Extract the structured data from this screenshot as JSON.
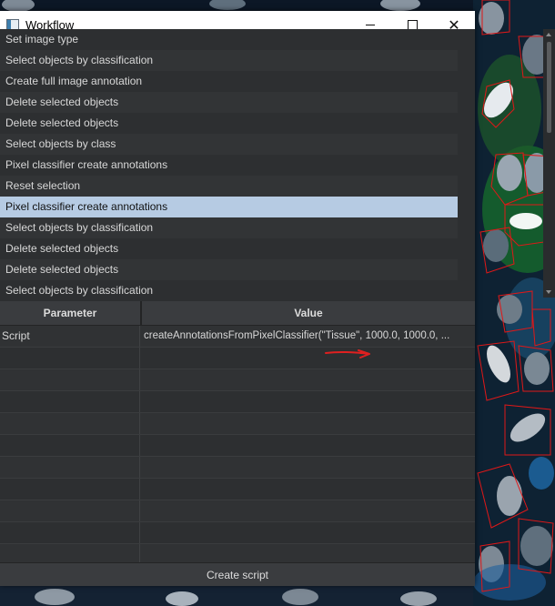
{
  "window": {
    "title": "Workflow",
    "icon": "workflow-app-icon"
  },
  "steps": [
    {
      "label": "Set image type"
    },
    {
      "label": "Select objects by classification"
    },
    {
      "label": "Create full image annotation"
    },
    {
      "label": "Delete selected objects"
    },
    {
      "label": "Delete selected objects"
    },
    {
      "label": "Select objects by class"
    },
    {
      "label": "Pixel classifier create annotations"
    },
    {
      "label": "Reset selection"
    },
    {
      "label": "Pixel classifier create annotations",
      "selected": true
    },
    {
      "label": "Select objects by classification"
    },
    {
      "label": "Delete selected objects"
    },
    {
      "label": "Delete selected objects"
    },
    {
      "label": "Select objects by classification"
    }
  ],
  "params_table": {
    "headers": {
      "parameter": "Parameter",
      "value": "Value"
    },
    "rows": [
      {
        "parameter": "Script",
        "value": "createAnnotationsFromPixelClassifier(\"Tissue\", 1000.0, 1000.0, ..."
      }
    ]
  },
  "bottom_button": {
    "label": "Create script"
  },
  "colors": {
    "selected_row": "#b6cbe3",
    "panel_bg": "#2d2f31",
    "annotation_arrow": "#e02020"
  }
}
